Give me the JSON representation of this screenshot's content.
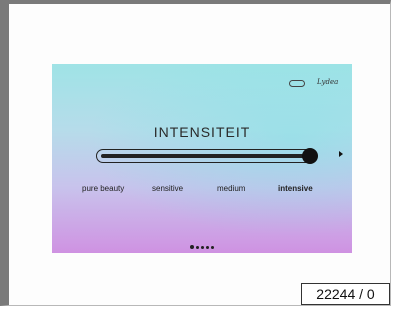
{
  "screen": {
    "brand_badge_text": "",
    "brand_logo_text": "Lydea",
    "title": "INTENSITEIT",
    "slider": {
      "options": [
        "pure beauty",
        "sensitive",
        "medium",
        "intensive"
      ],
      "selected_index": 3,
      "level_fraction": 1.0
    },
    "pager": {
      "total": 5,
      "active_index": 0
    }
  },
  "footer": {
    "counter": "22244 / 0"
  },
  "colors": {
    "gradient_top": "#9fe3e6",
    "gradient_bottom": "#cf92e2",
    "ink": "#222222"
  }
}
